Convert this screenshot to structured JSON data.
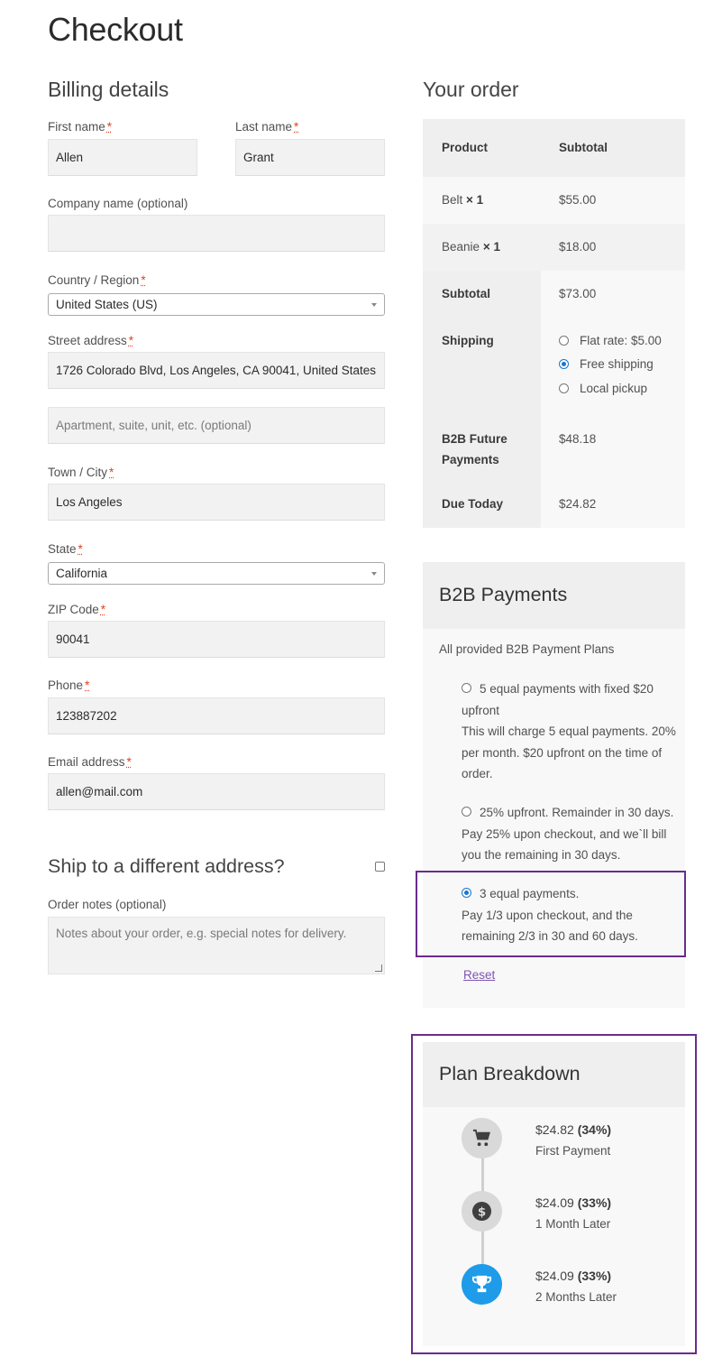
{
  "page": {
    "title": "Checkout"
  },
  "billing": {
    "heading": "Billing details",
    "first_name": {
      "label": "First name",
      "value": "Allen"
    },
    "last_name": {
      "label": "Last name",
      "value": "Grant"
    },
    "company": {
      "label": "Company name (optional)",
      "value": ""
    },
    "country": {
      "label": "Country / Region",
      "value": "United States (US)"
    },
    "street": {
      "label": "Street address",
      "value": "1726 Colorado Blvd, Los Angeles, CA 90041, United States",
      "placeholder2": "Apartment, suite, unit, etc. (optional)"
    },
    "city": {
      "label": "Town / City",
      "value": "Los Angeles"
    },
    "state": {
      "label": "State",
      "value": "California"
    },
    "zip": {
      "label": "ZIP Code",
      "value": "90041"
    },
    "phone": {
      "label": "Phone",
      "value": "123887202"
    },
    "email": {
      "label": "Email address",
      "value": "allen@mail.com"
    },
    "required_mark": "*",
    "ship_different": "Ship to a different address?",
    "order_notes": {
      "label": "Order notes (optional)",
      "placeholder": "Notes about your order, e.g. special notes for delivery."
    }
  },
  "order": {
    "heading": "Your order",
    "col_product": "Product",
    "col_subtotal": "Subtotal",
    "items": [
      {
        "name": "Belt",
        "qty": "× 1",
        "price": "$55.00"
      },
      {
        "name": "Beanie",
        "qty": "× 1",
        "price": "$18.00"
      }
    ],
    "subtotal_label": "Subtotal",
    "subtotal_value": "$73.00",
    "shipping_label": "Shipping",
    "shipping_options": [
      {
        "label": "Flat rate: $5.00",
        "selected": false
      },
      {
        "label": "Free shipping",
        "selected": true
      },
      {
        "label": "Local pickup",
        "selected": false
      }
    ],
    "future_label_1": "B2B Future",
    "future_label_2": "Payments",
    "future_value": "$48.18",
    "due_label": "Due Today",
    "due_value": "$24.82"
  },
  "b2b": {
    "title": "B2B Payments",
    "intro": "All provided B2B Payment Plans",
    "plans": [
      {
        "lines": [
          "5 equal payments with fixed $20",
          "upfront",
          "This will charge 5 equal payments. 20%",
          "per month. $20 upfront on the time of",
          "order."
        ],
        "selected": false
      },
      {
        "lines": [
          "25% upfront. Remainder in 30 days.",
          "Pay 25% upon checkout, and we`ll bill",
          "you the remaining in 30 days."
        ],
        "selected": false
      },
      {
        "lines": [
          "3 equal payments.",
          "Pay 1/3 upon checkout, and the",
          "remaining 2/3 in 30 and 60 days."
        ],
        "selected": true
      }
    ],
    "reset": "Reset",
    "highlight_color": "#6a2c8d"
  },
  "breakdown": {
    "title": "Plan Breakdown",
    "steps": [
      {
        "icon": "cart-icon",
        "amount": "$24.82",
        "pct": "(34%)",
        "label": "First Payment",
        "active": false
      },
      {
        "icon": "dollar-icon",
        "amount": "$24.09",
        "pct": "(33%)",
        "label": "1 Month Later",
        "active": false
      },
      {
        "icon": "trophy-icon",
        "amount": "$24.09",
        "pct": "(33%)",
        "label": "2 Months Later",
        "active": true
      }
    ],
    "active_color": "#1e9be9"
  }
}
